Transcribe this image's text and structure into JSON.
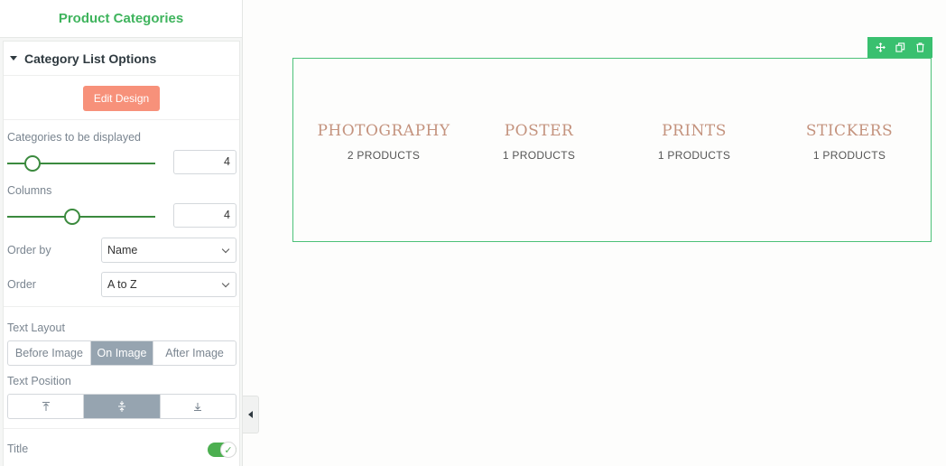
{
  "sidebar": {
    "title": "Product Categories",
    "section_title": "Category List Options",
    "edit_design_label": "Edit Design",
    "categories_label": "Categories to be displayed",
    "categories_value": "4",
    "categories_slider_level": 0.17,
    "columns_label": "Columns",
    "columns_value": "4",
    "columns_slider_level": 0.44,
    "order_by_label": "Order by",
    "order_by_value": "Name",
    "order_label": "Order",
    "order_value": "A to Z",
    "text_layout_label": "Text Layout",
    "text_layout_options": [
      "Before Image",
      "On Image",
      "After Image"
    ],
    "text_layout_selected": "On Image",
    "text_position_label": "Text Position",
    "text_position_options": [
      "top-align-icon",
      "middle-align-icon",
      "bottom-align-icon"
    ],
    "text_position_selected": "middle-align-icon",
    "title_toggle_label": "Title",
    "title_toggle_on": true
  },
  "widget": {
    "categories": [
      {
        "name": "PHOTOGRAPHY",
        "count": "2 PRODUCTS"
      },
      {
        "name": "POSTER",
        "count": "1 PRODUCTS"
      },
      {
        "name": "PRINTS",
        "count": "1 PRODUCTS"
      },
      {
        "name": "STICKERS",
        "count": "1 PRODUCTS"
      }
    ],
    "tools": [
      "move-icon",
      "duplicate-icon",
      "delete-icon"
    ]
  },
  "colors": {
    "brand_green": "#3fb45d",
    "edit_button": "#f7917a",
    "category_title": "#c4937e",
    "widget_border": "#4cc178",
    "active_segment": "#96a4b0"
  }
}
